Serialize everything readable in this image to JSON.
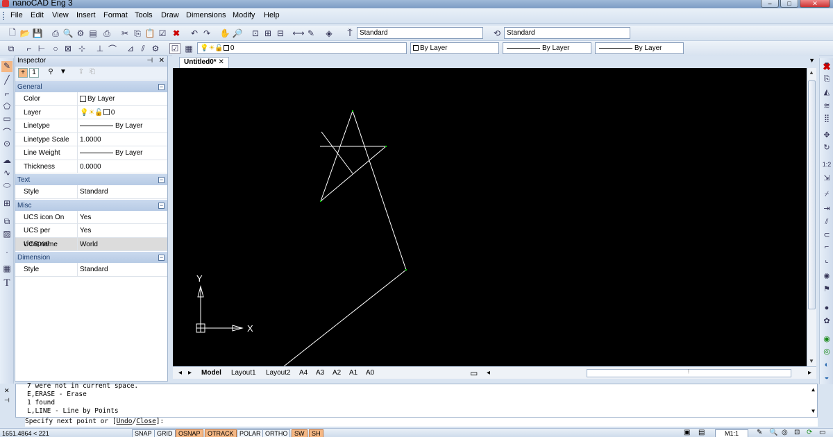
{
  "window": {
    "title": "nanoCAD Eng 3"
  },
  "menu": [
    "File",
    "Edit",
    "View",
    "Insert",
    "Format",
    "Tools",
    "Draw",
    "Dimensions",
    "Modify",
    "Help"
  ],
  "toolbar": {
    "text_style": "Standard",
    "dim_style": "Standard",
    "layer_value": "0",
    "color_value": "By Layer",
    "linetype_value": "By Layer",
    "lineweight_value": "By Layer"
  },
  "inspector": {
    "title": "Inspector",
    "sections": [
      {
        "name": "General",
        "rows": [
          {
            "key": "Color",
            "value": "By Layer"
          },
          {
            "key": "Layer",
            "value": "0"
          },
          {
            "key": "Linetype",
            "value": "By Layer"
          },
          {
            "key": "Linetype Scale",
            "value": "1.0000"
          },
          {
            "key": "Line Weight",
            "value": "By Layer"
          },
          {
            "key": "Thickness",
            "value": "0.0000"
          }
        ]
      },
      {
        "name": "Text",
        "rows": [
          {
            "key": "Style",
            "value": "Standard"
          }
        ]
      },
      {
        "name": "Misc",
        "rows": [
          {
            "key": "UCS icon On",
            "value": "Yes"
          },
          {
            "key": "UCS per viewport",
            "value": "Yes"
          },
          {
            "key": "UCS name",
            "value": "World"
          }
        ]
      },
      {
        "name": "Dimension",
        "rows": [
          {
            "key": "Style",
            "value": "Standard"
          }
        ]
      }
    ]
  },
  "document": {
    "tab": "Untitled0*"
  },
  "canvas": {
    "axis_x": "X",
    "axis_y": "Y"
  },
  "layout_tabs": [
    "Model",
    "Layout1",
    "Layout2",
    "A4",
    "A3",
    "A2",
    "A1",
    "A0"
  ],
  "command_history": [
    "7 were not in current space.",
    "E,ERASE - Erase",
    "1 found",
    "L,LINE - Line by Points"
  ],
  "command_prompt": {
    "prefix": "Specify next point or [",
    "opt1": "Undo",
    "sep": "/",
    "opt2": "Close",
    "suffix": "]:"
  },
  "status": {
    "coords": "1651.4864 < 221",
    "toggles": [
      {
        "label": "SNAP",
        "on": false
      },
      {
        "label": "GRID",
        "on": false
      },
      {
        "label": "OSNAP",
        "on": true
      },
      {
        "label": "OTRACK",
        "on": true
      },
      {
        "label": "POLAR",
        "on": false
      },
      {
        "label": "ORTHO",
        "on": false
      },
      {
        "label": "SW",
        "on": true
      },
      {
        "label": "SH",
        "on": true
      }
    ],
    "scale": "M1:1"
  },
  "colors": {
    "canvas": "#000000",
    "accent": "#f4b784",
    "line": "#ffffff"
  }
}
